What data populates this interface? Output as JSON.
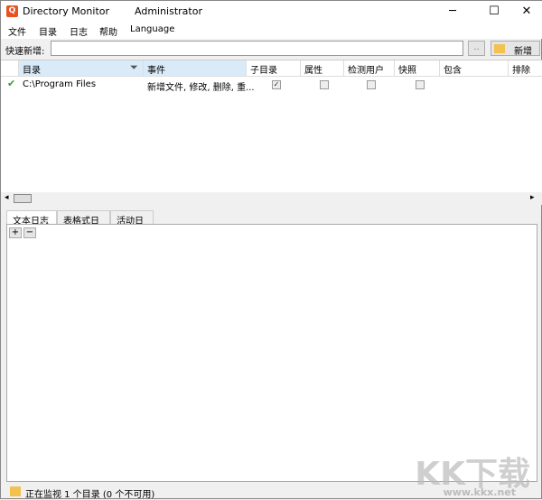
{
  "window": {
    "title": "Directory Monitor",
    "user": "Administrator",
    "icon": "magnifier-app-icon",
    "minimize": "─",
    "maximize": "☐",
    "close": "✕"
  },
  "menu": [
    "文件",
    "目录",
    "日志",
    "帮助",
    "Language"
  ],
  "quick_add": {
    "label": "快速新增:",
    "value": "",
    "browse": "..",
    "add": "新增"
  },
  "columns": [
    "目录",
    "事件",
    "子目录",
    "属性",
    "检测用户",
    "快照",
    "包含",
    "排除"
  ],
  "rows": [
    {
      "status": "✔",
      "directory": "C:\\Program Files",
      "events": "新增文件, 修改, 删除, 重...",
      "subdirs": true,
      "attributes": false,
      "detect_user": false,
      "snapshot": false,
      "include": "",
      "exclude": ""
    }
  ],
  "tabs": [
    "文本日志",
    "表格式日志",
    "活动日志"
  ],
  "log_buttons": {
    "expand": "+",
    "collapse": "−"
  },
  "status": "正在监视 1 个目录 (0 个不可用)",
  "watermark": {
    "logo": "KK下载",
    "url": "www.kkx.net"
  }
}
